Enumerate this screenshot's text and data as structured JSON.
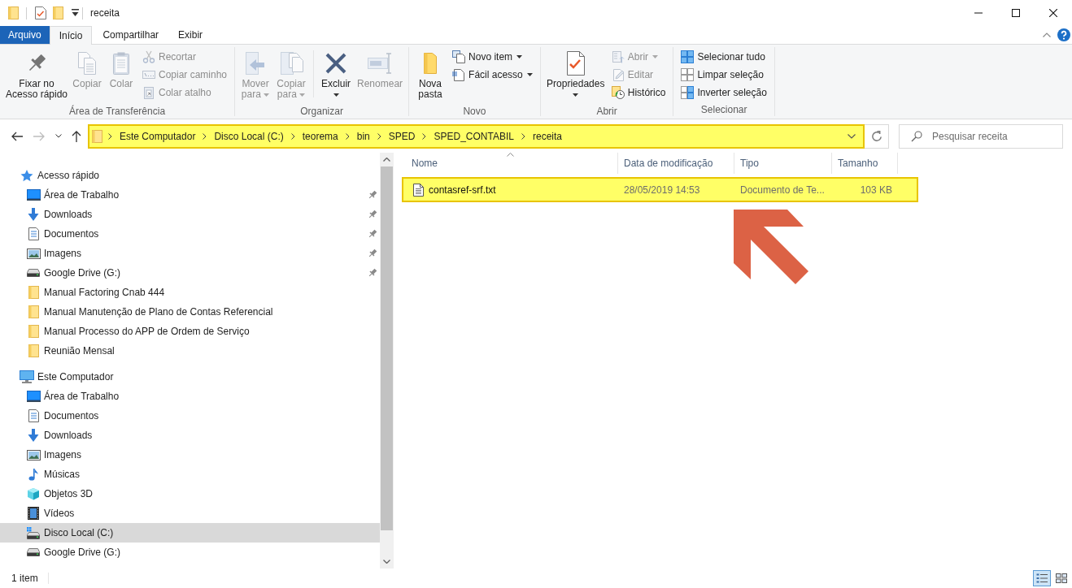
{
  "window": {
    "title": "receita"
  },
  "ribbon": {
    "tabs": [
      {
        "label": "Arquivo",
        "kind": "file_menu",
        "selected": false
      },
      {
        "label": "Início",
        "kind": "tab",
        "selected": true
      },
      {
        "label": "Compartilhar",
        "kind": "tab",
        "selected": false
      },
      {
        "label": "Exibir",
        "kind": "tab",
        "selected": false
      }
    ],
    "groups": [
      {
        "label": "Área de Transferência",
        "buttons": [
          {
            "kind": "large",
            "label": "Fixar no Acesso rápido",
            "disabled": false
          },
          {
            "kind": "large",
            "label": "Copiar",
            "disabled": true
          },
          {
            "kind": "large",
            "label": "Colar",
            "disabled": true
          },
          {
            "kind": "small",
            "label": "Recortar",
            "disabled": true
          },
          {
            "kind": "small",
            "label": "Copiar caminho",
            "disabled": true
          },
          {
            "kind": "small",
            "label": "Colar atalho",
            "disabled": true
          }
        ]
      },
      {
        "label": "Organizar",
        "buttons": [
          {
            "kind": "large",
            "label": "Mover para",
            "disabled": true,
            "dropdown": true
          },
          {
            "kind": "large",
            "label": "Copiar para",
            "disabled": true,
            "dropdown": true
          },
          {
            "kind": "separator"
          },
          {
            "kind": "large",
            "label": "Excluir",
            "disabled": false,
            "dropdown": true
          },
          {
            "kind": "large",
            "label": "Renomear",
            "disabled": true
          }
        ]
      },
      {
        "label": "Novo",
        "buttons": [
          {
            "kind": "large",
            "label": "Nova pasta",
            "disabled": false
          },
          {
            "kind": "small",
            "label": "Novo item",
            "disabled": false,
            "dropdown": true
          },
          {
            "kind": "small",
            "label": "Fácil acesso",
            "disabled": false,
            "dropdown": true
          }
        ]
      },
      {
        "label": "Abrir",
        "buttons": [
          {
            "kind": "large",
            "label": "Propriedades",
            "disabled": false,
            "dropdown": true
          },
          {
            "kind": "small",
            "label": "Abrir",
            "disabled": true,
            "dropdown": true
          },
          {
            "kind": "small",
            "label": "Editar",
            "disabled": true
          },
          {
            "kind": "small",
            "label": "Histórico",
            "disabled": false
          }
        ]
      },
      {
        "label": "Selecionar",
        "buttons": [
          {
            "kind": "small",
            "label": "Selecionar tudo",
            "disabled": false
          },
          {
            "kind": "small",
            "label": "Limpar seleção",
            "disabled": false
          },
          {
            "kind": "small",
            "label": "Inverter seleção",
            "disabled": false
          }
        ]
      }
    ]
  },
  "history_buttons": [
    {
      "kind": "back",
      "disabled": false
    },
    {
      "kind": "forward",
      "disabled": true
    },
    {
      "kind": "recent",
      "disabled": false
    },
    {
      "kind": "up",
      "disabled": false
    }
  ],
  "address_bar": {
    "highlighted": true,
    "segments": [
      "Este Computador",
      "Disco Local (C:)",
      "teorema",
      "bin",
      "SPED",
      "SPED_CONTABIL",
      "receita"
    ]
  },
  "search": {
    "placeholder": "Pesquisar receita"
  },
  "navigation": {
    "items": [
      {
        "label": "Acesso rápido",
        "selected": false,
        "children": [
          {
            "label": "Área de Trabalho",
            "pinned": true,
            "selected": false
          },
          {
            "label": "Downloads",
            "pinned": true,
            "selected": false
          },
          {
            "label": "Documentos",
            "pinned": true,
            "selected": false
          },
          {
            "label": "Imagens",
            "pinned": true,
            "selected": false
          },
          {
            "label": "Google Drive (G:)",
            "pinned": true,
            "selected": false
          },
          {
            "label": "Manual Factoring Cnab 444",
            "pinned": false,
            "selected": false
          },
          {
            "label": "Manual Manutenção de Plano de Contas Referencial",
            "pinned": false,
            "selected": false
          },
          {
            "label": "Manual Processo do APP de Ordem de Serviço",
            "pinned": false,
            "selected": false
          },
          {
            "label": "Reunião Mensal",
            "pinned": false,
            "selected": false
          }
        ]
      },
      {
        "label": "Este Computador",
        "selected": false,
        "children": [
          {
            "label": "Área de Trabalho",
            "selected": false
          },
          {
            "label": "Documentos",
            "selected": false
          },
          {
            "label": "Downloads",
            "selected": false
          },
          {
            "label": "Imagens",
            "selected": false
          },
          {
            "label": "Músicas",
            "selected": false
          },
          {
            "label": "Objetos 3D",
            "selected": false
          },
          {
            "label": "Vídeos",
            "selected": false
          },
          {
            "label": "Disco Local (C:)",
            "selected": true
          },
          {
            "label": "Google Drive (G:)",
            "selected": false
          }
        ]
      }
    ]
  },
  "file_list": {
    "columns": [
      {
        "label": "Nome",
        "sorted": true
      },
      {
        "label": "Data de modificação",
        "sorted": false
      },
      {
        "label": "Tipo",
        "sorted": false
      },
      {
        "label": "Tamanho",
        "sorted": false
      }
    ],
    "rows": [
      {
        "highlighted": true,
        "cells": [
          "contasref-srf.txt",
          "28/05/2019 14:53",
          "Documento de Te...",
          "103 KB"
        ]
      }
    ]
  },
  "status_bar": {
    "item_count": "1 item",
    "views": [
      {
        "selected": true
      },
      {
        "selected": false
      }
    ]
  }
}
